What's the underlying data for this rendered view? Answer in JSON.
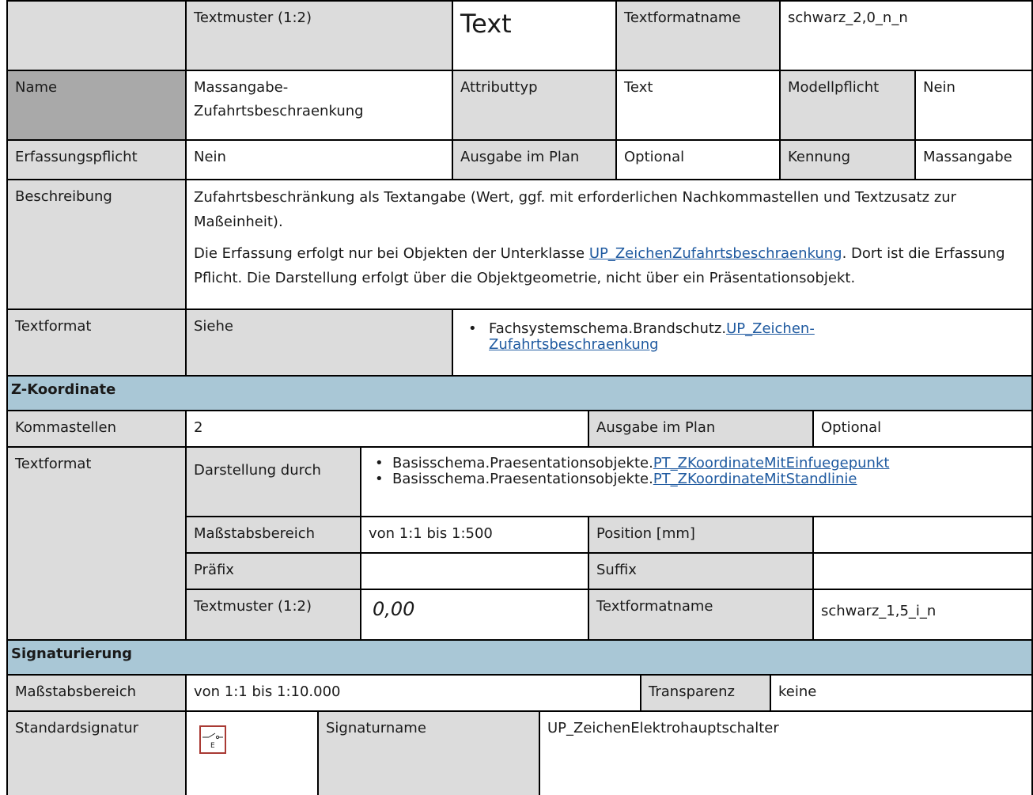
{
  "header_row": {
    "textmuster_label": "Textmuster (1:2)",
    "textmuster_sample": "Text",
    "textformatname_label": "Textformatname",
    "textformatname_value": "schwarz_2,0_n_n"
  },
  "attribute": {
    "name_label": "Name",
    "name_value_line1": "Massangabe-",
    "name_value_line2": "Zufahrtsbeschraenkung",
    "attributtyp_label": "Attributtyp",
    "attributtyp_value": "Text",
    "modellpflicht_label": "Modellpflicht",
    "modellpflicht_value": "Nein",
    "erfassungspflicht_label": "Erfassungspflicht",
    "erfassungspflicht_value": "Nein",
    "ausgabe_label": "Ausgabe im Plan",
    "ausgabe_value": "Optional",
    "kennung_label": "Kennung",
    "kennung_value": "Massangabe",
    "beschreibung_label": "Beschreibung",
    "beschreibung_p1": "Zufahrtsbeschränkung als Textangabe (Wert, ggf. mit erforderlichen Nachkommastellen und Textzusatz zur Maßeinheit).",
    "beschreibung_p2_before": "Die Erfassung erfolgt nur bei Objekten der Unterklasse ",
    "beschreibung_p2_link": "UP_ZeichenZufahrtsbeschraenkung",
    "beschreibung_p2_after": ". Dort ist die Er­fassung Pflicht. Die Darstellung erfolgt über die Objektgeometrie, nicht über ein Präsentationsobjekt.",
    "textformat_label": "Textformat",
    "siehe_label": "Siehe",
    "siehe_item_prefix": "Fachsystemschema.Brandschutz.",
    "siehe_item_link_line1": "UP_Zeichen-",
    "siehe_item_link_line2": "Zufahrtsbeschraenkung"
  },
  "z_koordinate": {
    "section_title": "Z-Koordinate",
    "kommastellen_label": "Kommastellen",
    "kommastellen_value": "2",
    "ausgabe_label": "Ausgabe im Plan",
    "ausgabe_value": "Optional",
    "textformat_label": "Textformat",
    "darstellung_label": "Darstellung durch",
    "darstellung_items": [
      {
        "prefix": "Basisschema.Praesentationsobjekte.",
        "link": "PT_ZKoordinateMitEinfuegepunkt"
      },
      {
        "prefix": "Basisschema.Praesentationsobjekte.",
        "link": "PT_ZKoordinateMitStandlinie"
      }
    ],
    "massstab_label": "Maßstabsbereich",
    "massstab_value": "von 1:1 bis 1:500",
    "position_label": "Position [mm]",
    "position_value": "",
    "praefix_label": "Präfix",
    "praefix_value": "",
    "suffix_label": "Suffix",
    "suffix_value": "",
    "textmuster_label": "Textmuster (1:2)",
    "textmuster_sample": "0,00",
    "textformatname_label": "Textformatname",
    "textformatname_value": "schwarz_1,5_i_n"
  },
  "signaturierung": {
    "section_title": "Signaturierung",
    "massstab_label": "Maßstabsbereich",
    "massstab_value": "von 1:1 bis 1:10.000",
    "transparenz_label": "Transparenz",
    "transparenz_value": "keine",
    "standardsignatur_label": "Standardsignatur",
    "signature_icon": "electrical-main-switch-symbol",
    "signature_icon_letter": "E",
    "signaturname_label": "Signaturname",
    "signaturname_value": "UP_ZeichenElektrohauptschalter"
  },
  "colors": {
    "label_gray": "#dcdcdc",
    "name_dark_gray": "#a9a9a9",
    "section_blue": "#a9c7d6",
    "link_blue": "#1f5aa0",
    "symbol_red": "#a93a34"
  }
}
